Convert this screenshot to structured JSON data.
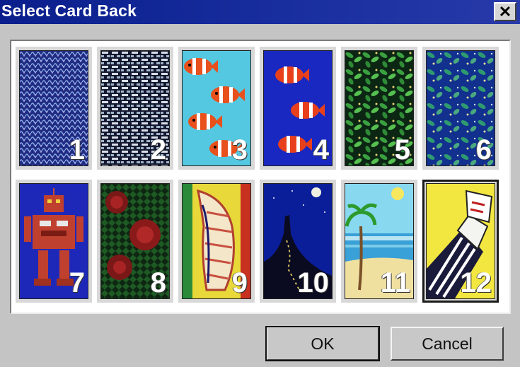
{
  "window": {
    "title": "Select Card Back",
    "close_label": "✕"
  },
  "cards": [
    {
      "number": "1",
      "design": "blue-weave"
    },
    {
      "number": "2",
      "design": "brick-lattice"
    },
    {
      "number": "3",
      "design": "clownfish-aqua"
    },
    {
      "number": "4",
      "design": "clownfish-blue"
    },
    {
      "number": "5",
      "design": "green-vines"
    },
    {
      "number": "6",
      "design": "blue-leaves"
    },
    {
      "number": "7",
      "design": "robot"
    },
    {
      "number": "8",
      "design": "roses"
    },
    {
      "number": "9",
      "design": "seashell"
    },
    {
      "number": "10",
      "design": "castle-night"
    },
    {
      "number": "11",
      "design": "palm-beach"
    },
    {
      "number": "12",
      "design": "hand-cards"
    }
  ],
  "selected_card": "12",
  "buttons": {
    "ok": "OK",
    "cancel": "Cancel"
  }
}
